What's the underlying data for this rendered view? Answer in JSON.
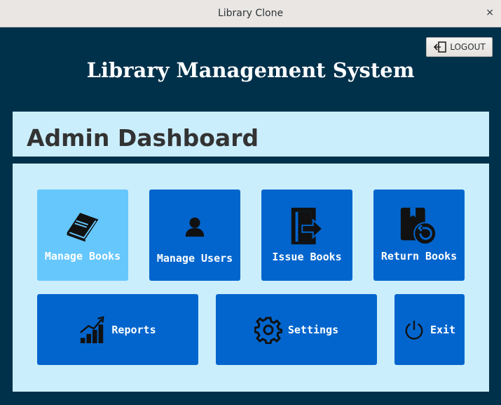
{
  "window": {
    "title": "Library Clone",
    "close_glyph": "×"
  },
  "header": {
    "logout_label": "LOGOUT",
    "logout_icon": "logout-icon",
    "app_title": "Library Management System"
  },
  "dashboard": {
    "title": "Admin Dashboard",
    "tiles": [
      {
        "label": "Manage Books",
        "icon": "book-icon",
        "active": true
      },
      {
        "label": "Manage Users",
        "icon": "user-icon",
        "active": false
      },
      {
        "label": "Issue Books",
        "icon": "issue-book-icon",
        "active": false
      },
      {
        "label": "Return Books",
        "icon": "return-book-icon",
        "active": false
      },
      {
        "label": "Reports",
        "icon": "bar-chart-icon",
        "active": false
      },
      {
        "label": "Settings",
        "icon": "gear-icon",
        "active": false
      },
      {
        "label": "Exit",
        "icon": "power-icon",
        "active": false
      }
    ]
  },
  "colors": {
    "background": "#00314b",
    "panel": "#cbeefd",
    "tile": "#0265cd",
    "tile_active": "#66c7fd"
  }
}
